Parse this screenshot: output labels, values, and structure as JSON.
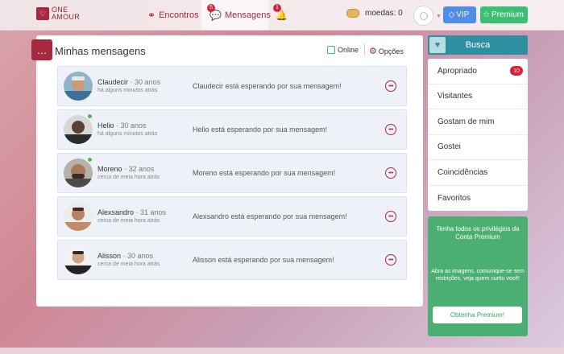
{
  "brand": {
    "logo_text_line1": "ONE",
    "logo_text_line2": "AMOUR"
  },
  "nav": {
    "encontros": "Encontros",
    "mensagens": "Mensagens",
    "mensagens_badge": "5",
    "notifications_badge": "1"
  },
  "coins": {
    "label": "moedas: 0"
  },
  "buttons": {
    "vip": "VIP",
    "premium": "Premium"
  },
  "main": {
    "title": "Minhas mensagens",
    "online_label": "Online",
    "options_label": "Opções"
  },
  "conversations": [
    {
      "name": "Claudecir",
      "age": "30 anos",
      "time": "há alguns minutos atrás",
      "preview": "Claudecir está esperando por sua mensagem!",
      "online": false
    },
    {
      "name": "Helio",
      "age": "30 anos",
      "time": "há alguns minutos atrás",
      "preview": "Helio está esperando por sua mensagem!",
      "online": true
    },
    {
      "name": "Moreno",
      "age": "32 anos",
      "time": "cerca de meia hora atrás",
      "preview": "Moreno está esperando por sua mensagem!",
      "online": true
    },
    {
      "name": "Alexsandro",
      "age": "31 anos",
      "time": "cerca de meia hora atrás",
      "preview": "Alexsandro está esperando por sua mensagem!",
      "online": false
    },
    {
      "name": "Alisson",
      "age": "30 anos",
      "time": "cerca de meia hora atrás",
      "preview": "Alisson está esperando por sua mensagem!",
      "online": false
    }
  ],
  "sidebar": {
    "search_label": "Busca",
    "items": [
      {
        "label": "Apropriado",
        "badge": "10"
      },
      {
        "label": "Visitantes"
      },
      {
        "label": "Gostam de mim"
      },
      {
        "label": "Gostei"
      },
      {
        "label": "Coincidências"
      },
      {
        "label": "Favoritos"
      }
    ]
  },
  "promo": {
    "title": "Tenha todos os privilégios da Conta Premium",
    "text": "Abra as imagens, comunique-se sem restrições, veja quem curtiu você!",
    "button": "Obtenha Premium!"
  },
  "colors": {
    "accent": "#a8283f",
    "teal": "#2e8fa0",
    "green": "#4caf72",
    "vip_blue": "#4f8de6"
  }
}
